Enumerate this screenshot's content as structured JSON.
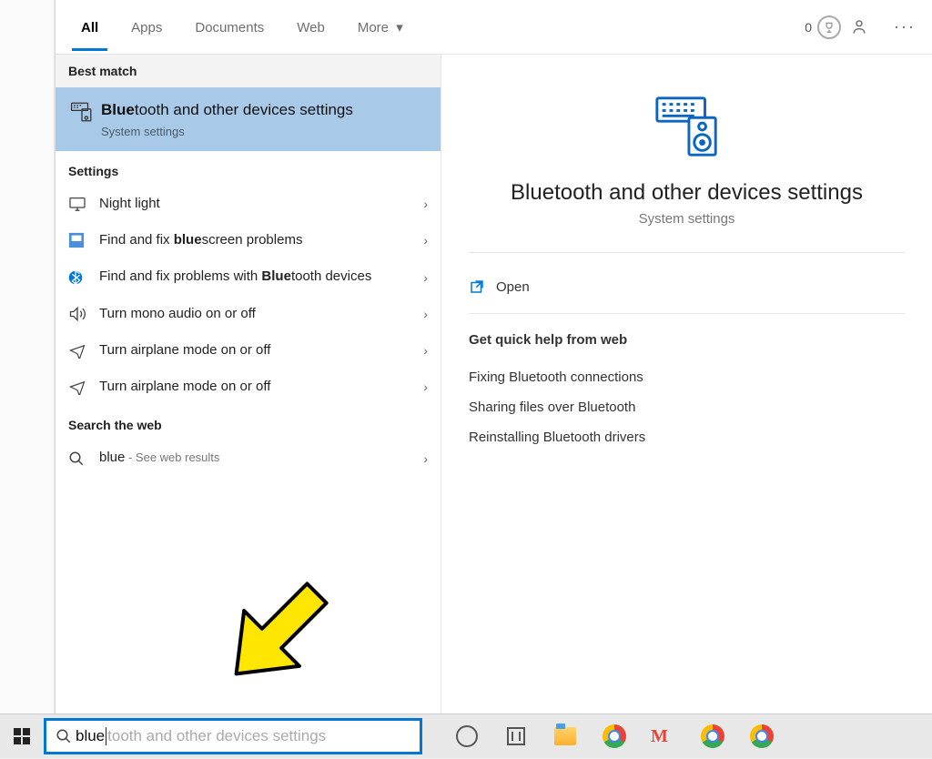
{
  "tabs": {
    "all": "All",
    "apps": "Apps",
    "documents": "Documents",
    "web": "Web",
    "more": "More"
  },
  "header": {
    "points": "0"
  },
  "section_best_match": "Best match",
  "best_match": {
    "title_prefix_bold": "Blue",
    "title_rest": "tooth and other devices settings",
    "subtitle": "System settings"
  },
  "section_settings": "Settings",
  "settings_results": [
    {
      "icon": "monitor",
      "pre": "",
      "bold": "",
      "post": "Night light"
    },
    {
      "icon": "fixit",
      "pre": "Find and fix ",
      "bold": "blue",
      "post": "screen problems"
    },
    {
      "icon": "bluetooth",
      "pre": "Find and fix problems with ",
      "bold": "Blue",
      "post": "tooth devices"
    },
    {
      "icon": "speaker",
      "pre": "",
      "bold": "",
      "post": "Turn mono audio on or off"
    },
    {
      "icon": "airplane",
      "pre": "",
      "bold": "",
      "post": "Turn airplane mode on or off"
    },
    {
      "icon": "airplane",
      "pre": "",
      "bold": "",
      "post": "Turn airplane mode on or off"
    }
  ],
  "section_web": "Search the web",
  "web_result": {
    "query": "blue",
    "suffix": " - See web results"
  },
  "preview": {
    "title": "Bluetooth and other devices settings",
    "subtitle": "System settings",
    "open_label": "Open",
    "help_header": "Get quick help from web",
    "help_links": [
      "Fixing Bluetooth connections",
      "Sharing files over Bluetooth",
      "Reinstalling Bluetooth drivers"
    ]
  },
  "searchbar": {
    "typed": "blue",
    "suggestion": "tooth and other devices settings"
  }
}
